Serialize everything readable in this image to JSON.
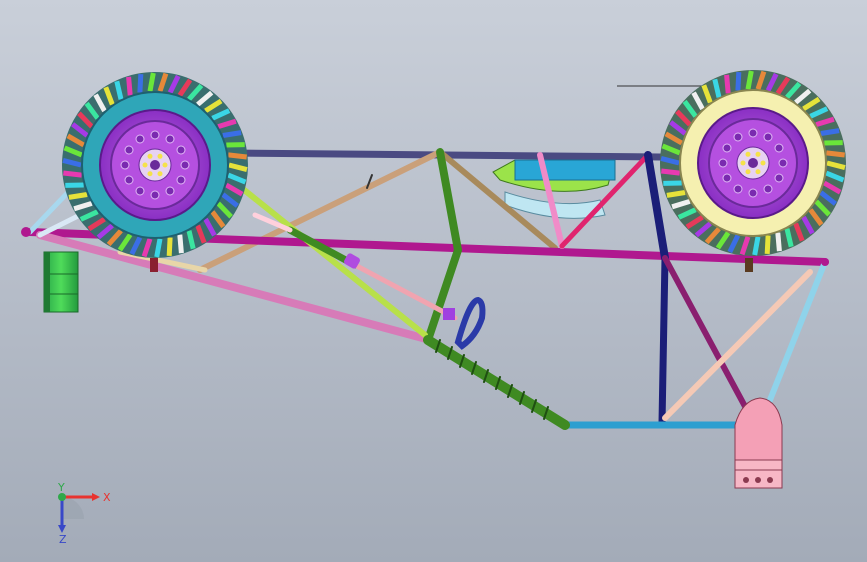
{
  "viewport": {
    "background_top": "#c9cfd9",
    "background_bottom": "#a3abb8"
  },
  "triad": {
    "x_label": "X",
    "y_label": "Y",
    "z_label": "Z",
    "x_color": "#e8332f",
    "y_color": "#2fa84a",
    "z_color": "#3848c8"
  },
  "model": {
    "description_icons": [
      "wheel-icon",
      "tube-frame-icon",
      "steering-wheel-icon",
      "bracket-icon",
      "green-cylinder-icon"
    ],
    "frame_colors": {
      "top_rail": "#3b3b6e",
      "main_diagonal": "#b0188f",
      "lower_pink": "#d77bb8",
      "green_post": "#3f8a22",
      "navy_post": "#1b1e78",
      "cyan_floor": "#2d9fd0",
      "light_blue": "#8fd3ea",
      "tan": "#a88a5c",
      "yellow_green": "#b8e04a"
    }
  }
}
